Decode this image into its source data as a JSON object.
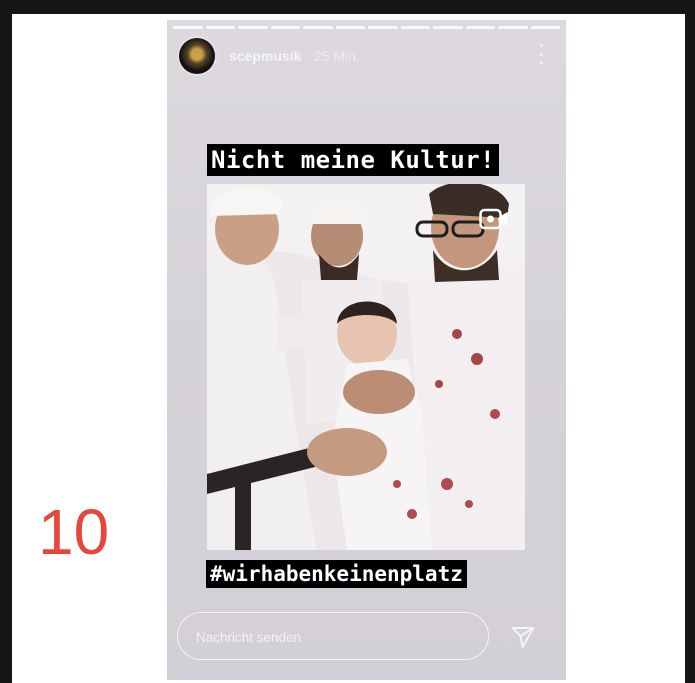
{
  "story": {
    "username": "scepmusik",
    "time": "25 Min.",
    "caption": "Nicht meine Kultur!",
    "hashtag": "#wirhabenkeinenplatz",
    "progress_segments": 12,
    "reply": {
      "placeholder": "Nachricht senden"
    },
    "icons": {
      "more": "more-options-icon",
      "send": "send-icon",
      "reels": "reels-icon"
    }
  },
  "overlay": {
    "slide_number": "10",
    "color": "#e5483a"
  }
}
